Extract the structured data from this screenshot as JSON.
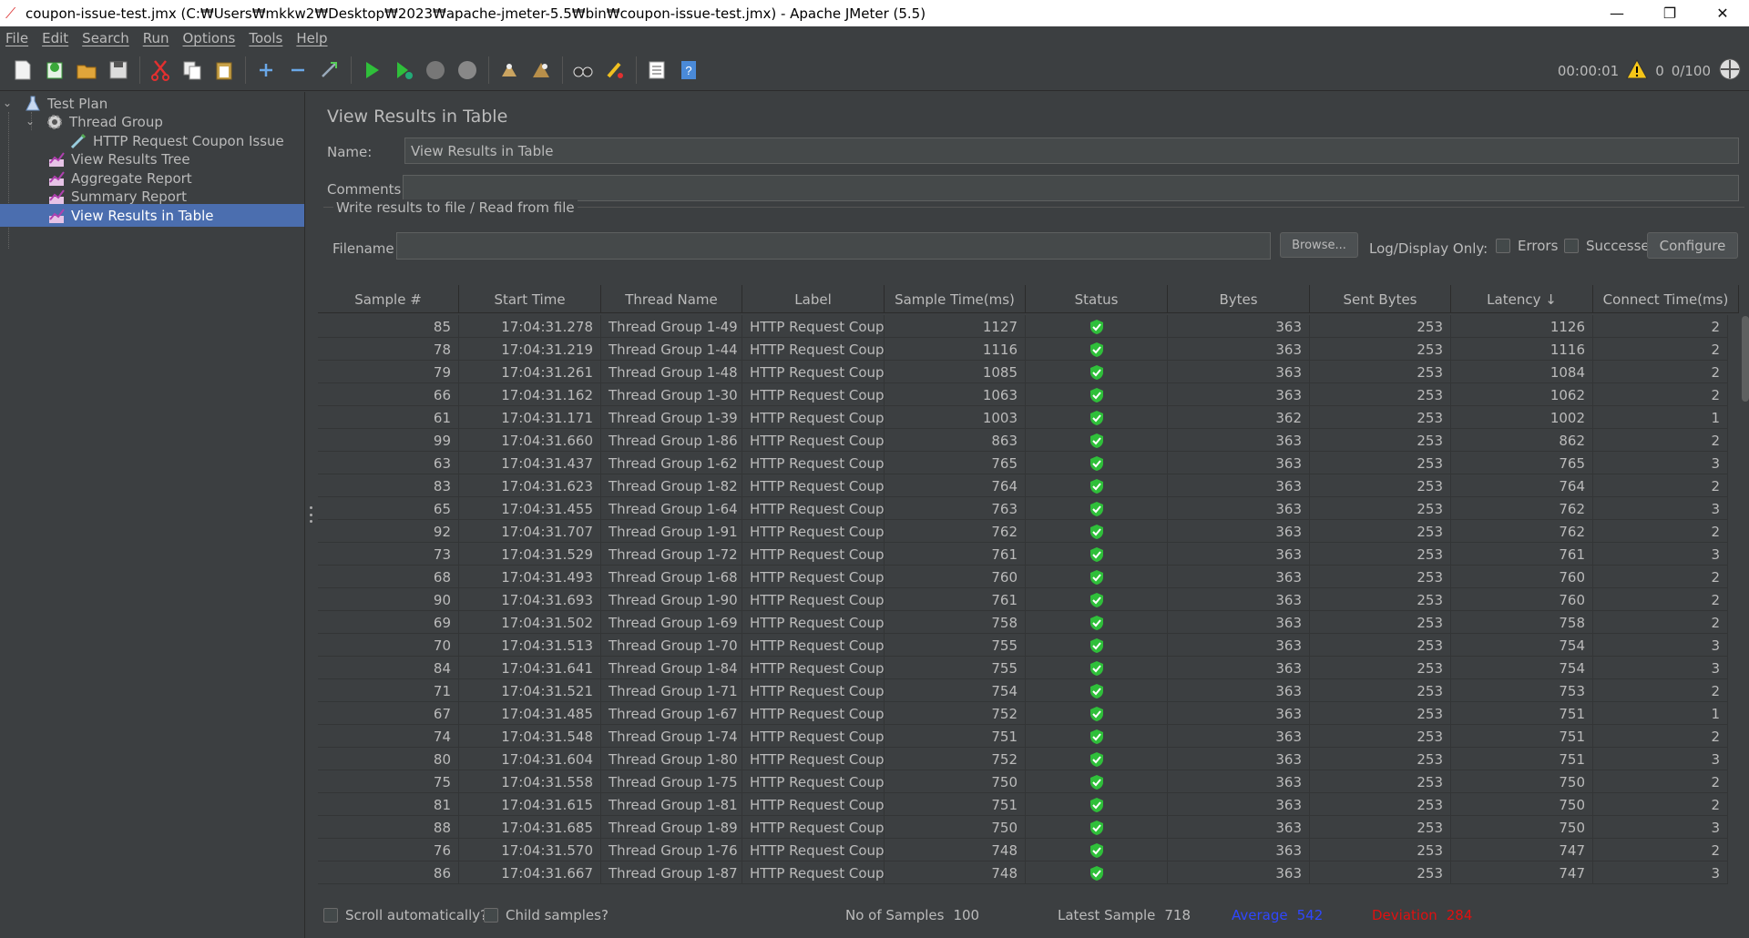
{
  "window": {
    "title": "coupon-issue-test.jmx (C:₩Users₩mkkw2₩Desktop₩2023₩apache-jmeter-5.5₩bin₩coupon-issue-test.jmx) - Apache JMeter (5.5)",
    "minimize": "—",
    "restore": "❐",
    "close": "✕"
  },
  "menu": [
    "File",
    "Edit",
    "Search",
    "Run",
    "Options",
    "Tools",
    "Help"
  ],
  "toolbar_status": {
    "timer": "00:00:01",
    "warning_count": "0",
    "threads": "0/100"
  },
  "tree": {
    "items": [
      {
        "label": "Test Plan",
        "icon": "flask-icon"
      },
      {
        "label": "Thread Group",
        "icon": "gear-icon"
      },
      {
        "label": "HTTP Request Coupon Issue",
        "icon": "pipette-icon"
      },
      {
        "label": "View Results Tree",
        "icon": "chart-icon"
      },
      {
        "label": "Aggregate Report",
        "icon": "chart-icon"
      },
      {
        "label": "Summary Report",
        "icon": "chart-icon"
      },
      {
        "label": "View Results in Table",
        "icon": "chart-icon"
      }
    ]
  },
  "panel": {
    "title": "View Results in Table",
    "name_label": "Name:",
    "name_value": "View Results in Table",
    "comments_label": "Comments:",
    "comments_value": "",
    "fileset_legend": "Write results to file / Read from file",
    "filename_label": "Filename",
    "filename_value": "",
    "browse_label": "Browse...",
    "log_display_label": "Log/Display Only:",
    "errors_label": "Errors",
    "successes_label": "Successes",
    "configure_label": "Configure"
  },
  "table": {
    "columns": [
      "Sample #",
      "Start Time",
      "Thread Name",
      "Label",
      "Sample Time(ms)",
      "Status",
      "Bytes",
      "Sent Bytes",
      "Latency ↓",
      "Connect Time(ms)"
    ],
    "rows": [
      [
        "85",
        "17:04:31.278",
        "Thread Group 1-49",
        "HTTP Request Coup...",
        "1127",
        "ok",
        "363",
        "253",
        "1126",
        "2"
      ],
      [
        "78",
        "17:04:31.219",
        "Thread Group 1-44",
        "HTTP Request Coup...",
        "1116",
        "ok",
        "363",
        "253",
        "1116",
        "2"
      ],
      [
        "79",
        "17:04:31.261",
        "Thread Group 1-48",
        "HTTP Request Coup...",
        "1085",
        "ok",
        "363",
        "253",
        "1084",
        "2"
      ],
      [
        "66",
        "17:04:31.162",
        "Thread Group 1-30",
        "HTTP Request Coup...",
        "1063",
        "ok",
        "363",
        "253",
        "1062",
        "2"
      ],
      [
        "61",
        "17:04:31.171",
        "Thread Group 1-39",
        "HTTP Request Coup...",
        "1003",
        "ok",
        "362",
        "253",
        "1002",
        "1"
      ],
      [
        "99",
        "17:04:31.660",
        "Thread Group 1-86",
        "HTTP Request Coup...",
        "863",
        "ok",
        "363",
        "253",
        "862",
        "2"
      ],
      [
        "63",
        "17:04:31.437",
        "Thread Group 1-62",
        "HTTP Request Coup...",
        "765",
        "ok",
        "363",
        "253",
        "765",
        "3"
      ],
      [
        "83",
        "17:04:31.623",
        "Thread Group 1-82",
        "HTTP Request Coup...",
        "764",
        "ok",
        "363",
        "253",
        "764",
        "2"
      ],
      [
        "65",
        "17:04:31.455",
        "Thread Group 1-64",
        "HTTP Request Coup...",
        "763",
        "ok",
        "363",
        "253",
        "762",
        "3"
      ],
      [
        "92",
        "17:04:31.707",
        "Thread Group 1-91",
        "HTTP Request Coup...",
        "762",
        "ok",
        "363",
        "253",
        "762",
        "2"
      ],
      [
        "73",
        "17:04:31.529",
        "Thread Group 1-72",
        "HTTP Request Coup...",
        "761",
        "ok",
        "363",
        "253",
        "761",
        "3"
      ],
      [
        "68",
        "17:04:31.493",
        "Thread Group 1-68",
        "HTTP Request Coup...",
        "760",
        "ok",
        "363",
        "253",
        "760",
        "2"
      ],
      [
        "90",
        "17:04:31.693",
        "Thread Group 1-90",
        "HTTP Request Coup...",
        "761",
        "ok",
        "363",
        "253",
        "760",
        "2"
      ],
      [
        "69",
        "17:04:31.502",
        "Thread Group 1-69",
        "HTTP Request Coup...",
        "758",
        "ok",
        "363",
        "253",
        "758",
        "2"
      ],
      [
        "70",
        "17:04:31.513",
        "Thread Group 1-70",
        "HTTP Request Coup...",
        "755",
        "ok",
        "363",
        "253",
        "754",
        "3"
      ],
      [
        "84",
        "17:04:31.641",
        "Thread Group 1-84",
        "HTTP Request Coup...",
        "755",
        "ok",
        "363",
        "253",
        "754",
        "3"
      ],
      [
        "71",
        "17:04:31.521",
        "Thread Group 1-71",
        "HTTP Request Coup...",
        "754",
        "ok",
        "363",
        "253",
        "753",
        "2"
      ],
      [
        "67",
        "17:04:31.485",
        "Thread Group 1-67",
        "HTTP Request Coup...",
        "752",
        "ok",
        "363",
        "253",
        "751",
        "1"
      ],
      [
        "74",
        "17:04:31.548",
        "Thread Group 1-74",
        "HTTP Request Coup...",
        "751",
        "ok",
        "363",
        "253",
        "751",
        "2"
      ],
      [
        "80",
        "17:04:31.604",
        "Thread Group 1-80",
        "HTTP Request Coup...",
        "752",
        "ok",
        "363",
        "253",
        "751",
        "3"
      ],
      [
        "75",
        "17:04:31.558",
        "Thread Group 1-75",
        "HTTP Request Coup...",
        "750",
        "ok",
        "363",
        "253",
        "750",
        "2"
      ],
      [
        "81",
        "17:04:31.615",
        "Thread Group 1-81",
        "HTTP Request Coup...",
        "751",
        "ok",
        "363",
        "253",
        "750",
        "2"
      ],
      [
        "88",
        "17:04:31.685",
        "Thread Group 1-89",
        "HTTP Request Coup...",
        "750",
        "ok",
        "363",
        "253",
        "750",
        "3"
      ],
      [
        "76",
        "17:04:31.570",
        "Thread Group 1-76",
        "HTTP Request Coup...",
        "748",
        "ok",
        "363",
        "253",
        "747",
        "2"
      ],
      [
        "86",
        "17:04:31.667",
        "Thread Group 1-87",
        "HTTP Request Coup...",
        "748",
        "ok",
        "363",
        "253",
        "747",
        "3"
      ]
    ]
  },
  "footer": {
    "scroll_auto_label": "Scroll automatically?",
    "child_samples_label": "Child samples?",
    "samples_label": "No of Samples",
    "samples_value": "100",
    "latest_label": "Latest Sample",
    "latest_value": "718",
    "average_label": "Average",
    "average_value": "542",
    "deviation_label": "Deviation",
    "deviation_value": "284"
  },
  "colors": {
    "background": "#3c3f41",
    "selection": "#4b6eaf",
    "text": "#bbbbbb",
    "average": "#2f47ff",
    "deviation": "#e01010",
    "ok_green": "#2fbf3a"
  }
}
